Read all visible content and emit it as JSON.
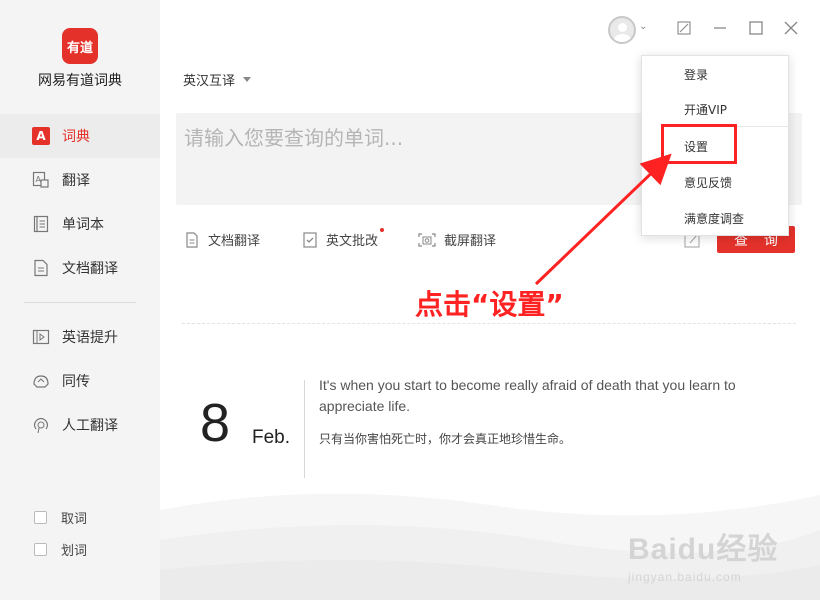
{
  "app": {
    "logo_text": "有道",
    "name": "网易有道词典"
  },
  "sidebar": {
    "nav": [
      {
        "label": "词典",
        "icon": "dictionary-icon",
        "active": true
      },
      {
        "label": "翻译",
        "icon": "translate-icon"
      },
      {
        "label": "单词本",
        "icon": "wordbook-icon"
      },
      {
        "label": "文档翻译",
        "icon": "document-translate-icon"
      },
      {
        "label": "英语提升",
        "icon": "english-improve-icon"
      },
      {
        "label": "同传",
        "icon": "simultaneous-interpretation-icon"
      },
      {
        "label": "人工翻译",
        "icon": "human-translation-icon"
      }
    ],
    "checks": [
      {
        "label": "取词",
        "checked": false
      },
      {
        "label": "划词",
        "checked": false
      }
    ]
  },
  "lang_select": {
    "value": "英汉互译"
  },
  "search": {
    "placeholder": "请输入您要查询的单词..."
  },
  "tools": [
    {
      "label": "文档翻译",
      "icon": "document-icon"
    },
    {
      "label": "英文批改",
      "icon": "correction-icon",
      "badge_dot": true
    },
    {
      "label": "截屏翻译",
      "icon": "screenshot-icon"
    }
  ],
  "query_button": {
    "label": "查 询"
  },
  "dropdown": {
    "items": [
      "登录",
      "开通VIP",
      "设置",
      "意见反馈",
      "满意度调查"
    ]
  },
  "annotation": {
    "text": "点击“设置”",
    "color": "#ff2222"
  },
  "daily": {
    "day": "8",
    "month": "Feb.",
    "quote_en": "It's when you start to become really afraid of death that you learn to appreciate life.",
    "quote_zh": "只有当你害怕死亡时，你才会真正地珍惜生命。"
  },
  "watermark": {
    "main": "Baidu经验",
    "sub": "jingyan.baidu.com"
  },
  "colors": {
    "accent": "#e4322b",
    "sidebar_bg": "#f4f4f4"
  }
}
